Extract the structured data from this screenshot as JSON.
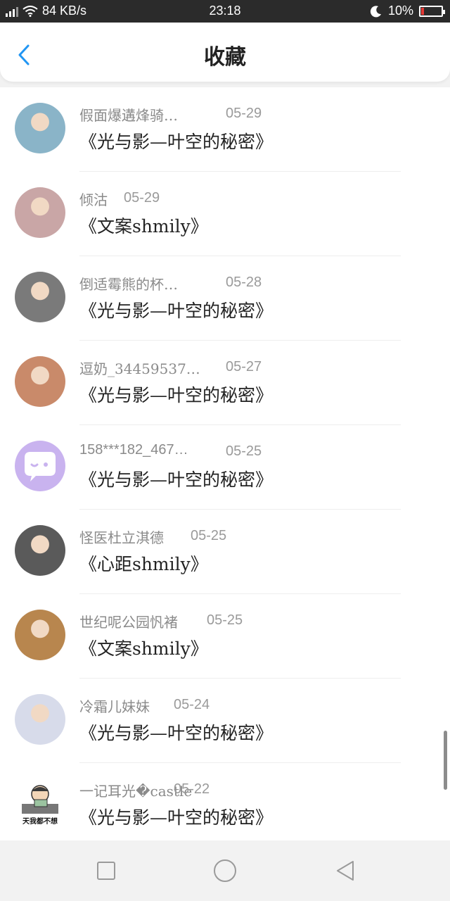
{
  "status_bar": {
    "network": "84 KB/s",
    "time": "23:18",
    "battery": "10%"
  },
  "header": {
    "title": "收藏"
  },
  "items": [
    {
      "user": "假面爆遘烽骑…",
      "date": "05-29",
      "work": "《光与影—叶空的秘密》",
      "avatar_color": "#8ab4c8"
    },
    {
      "user": "倾沽",
      "date": "05-29",
      "work": "《文案shmily》",
      "avatar_color": "#c9a6a6"
    },
    {
      "user": "倒适霉熊的杯…",
      "date": "05-28",
      "work": "《光与影—叶空的秘密》",
      "avatar_color": "#7a7a7a"
    },
    {
      "user": "逗奶_34459537…",
      "date": "05-27",
      "work": "《光与影—叶空的秘密》",
      "avatar_color": "#c98a6a"
    },
    {
      "user": "158***182_467…",
      "date": "05-25",
      "work": "《光与影—叶空的秘密》",
      "avatar_color": "#c9b3ef"
    },
    {
      "user": "怪医杜立淇德",
      "date": "05-25",
      "work": "《心距shmily》",
      "avatar_color": "#5a5a5a"
    },
    {
      "user": "世纪呢公园忛褚",
      "date": "05-25",
      "work": "《文案shmily》",
      "avatar_color": "#b8864e"
    },
    {
      "user": "冷霜儿妹妹",
      "date": "05-24",
      "work": "《光与影—叶空的秘密》",
      "avatar_color": "#d7dbea"
    },
    {
      "user": "一记耳光�castle",
      "date": "05-22",
      "work": "《光与影—叶空的秘密》",
      "avatar_color": "#e8e8e8",
      "avatar_text": "天我都不想"
    }
  ]
}
